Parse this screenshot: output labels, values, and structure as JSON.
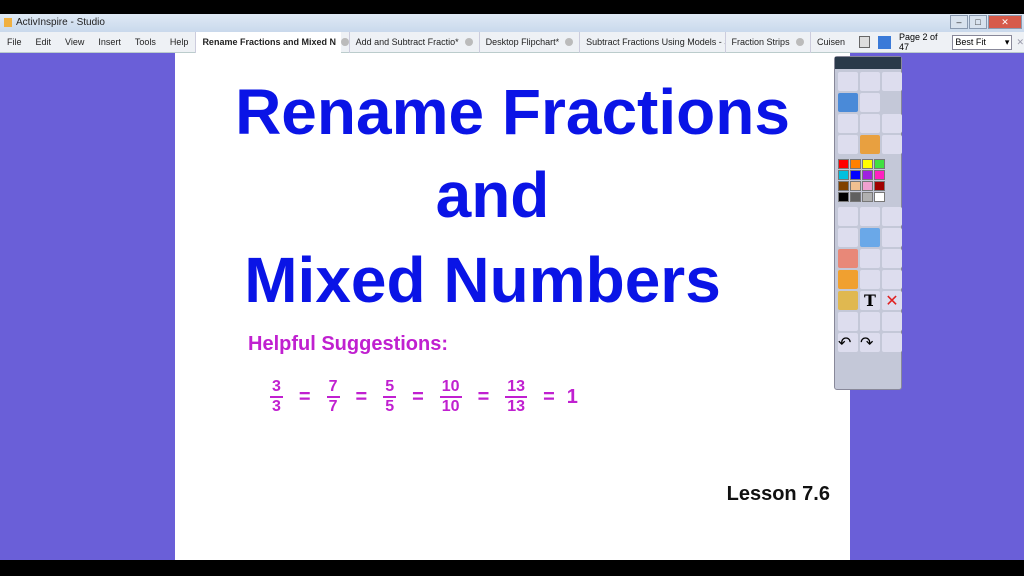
{
  "window": {
    "title": "ActivInspire - Studio"
  },
  "menu": [
    "File",
    "Edit",
    "View",
    "Insert",
    "Tools",
    "Help"
  ],
  "tabs": [
    {
      "label": "Rename Fractions and Mixed N",
      "active": true
    },
    {
      "label": "Add and Subtract Fractio*"
    },
    {
      "label": "Desktop Flipchart*"
    },
    {
      "label": "Subtract Fractions Using Models - S"
    },
    {
      "label": "Fraction Strips"
    },
    {
      "label": "Cuisen"
    }
  ],
  "page_indicator": "Page 2 of 47",
  "zoom_select": "Best Fit",
  "slide": {
    "title_lines": [
      "Rename Fractions",
      "and",
      "Mixed Numbers"
    ],
    "subtitle": "Helpful Suggestions:",
    "fractions": [
      {
        "n": "3",
        "d": "3"
      },
      {
        "n": "7",
        "d": "7"
      },
      {
        "n": "5",
        "d": "5"
      },
      {
        "n": "10",
        "d": "10"
      },
      {
        "n": "13",
        "d": "13"
      }
    ],
    "equals": "=",
    "result": "1",
    "lesson": "Lesson 7.6"
  },
  "colors": {
    "background": "#6a5fd8",
    "title": "#0a14e6",
    "accent": "#c020d0"
  },
  "palette": [
    "#ff0000",
    "#ff8000",
    "#ffff00",
    "#40e040",
    "#00c0e0",
    "#0000ff",
    "#a020e0",
    "#ff20c0",
    "#804000",
    "#f0c090",
    "#f0a0d0",
    "#a00000",
    "#000000",
    "#606060",
    "#b0b0b0",
    "#ffffff"
  ]
}
